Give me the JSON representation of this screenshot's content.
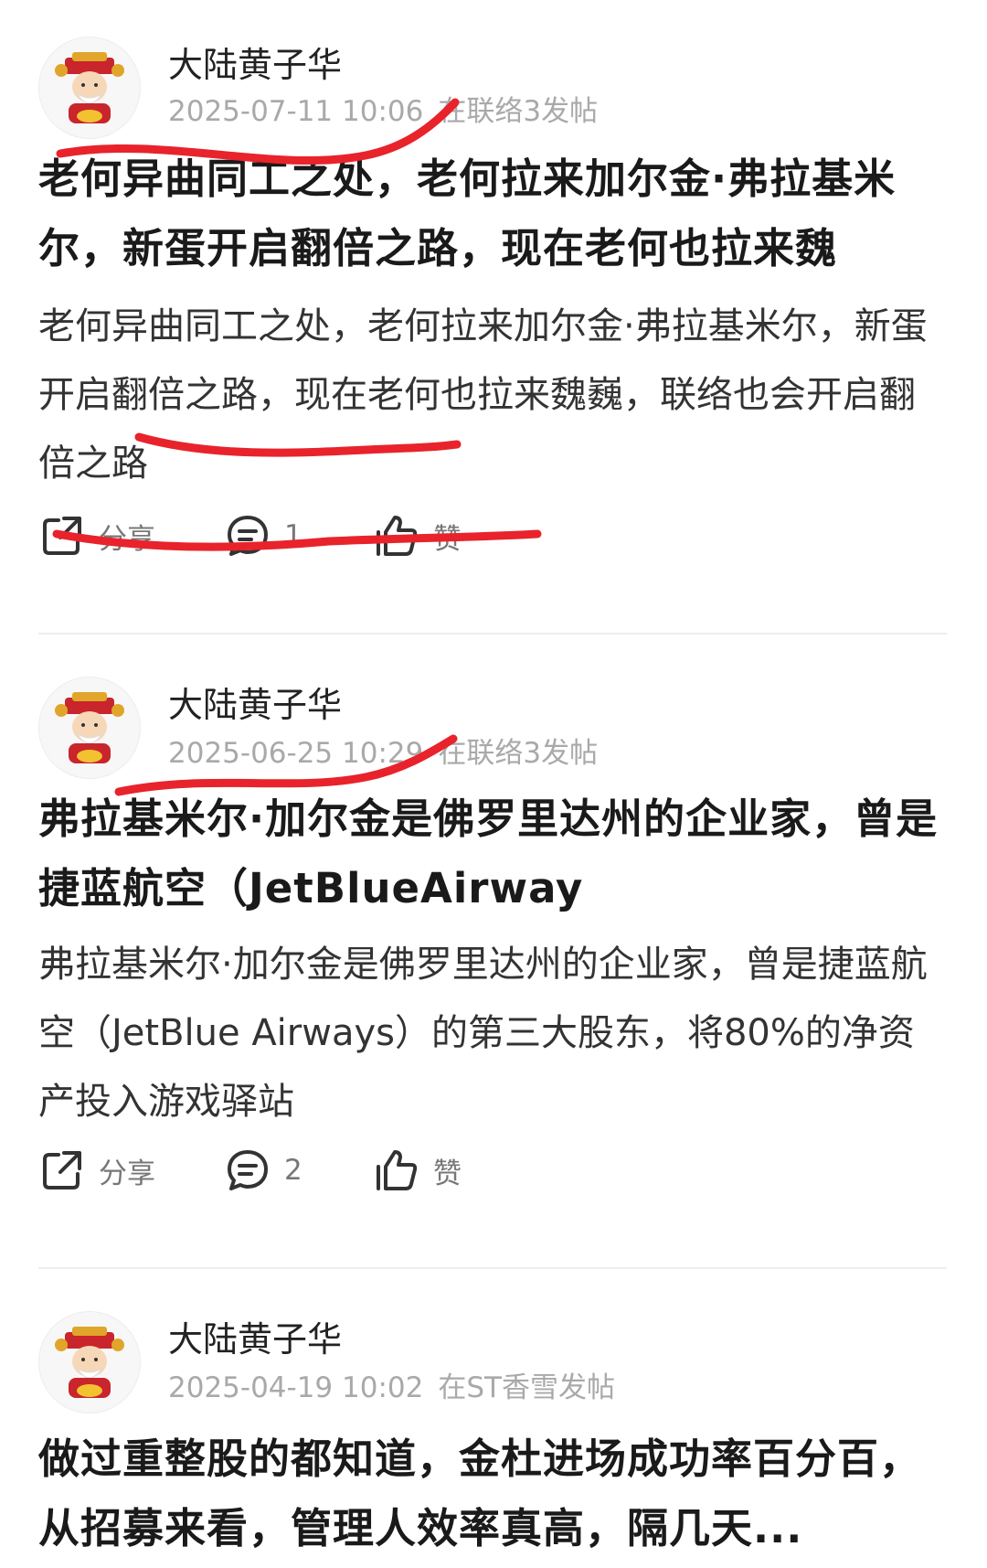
{
  "posts": [
    {
      "username": "大陆黄子华",
      "date": "2025-07-11 10:06",
      "source": "在联络3发帖",
      "title": "老何异曲同工之处，老何拉来加尔金·弗拉基米尔，新蛋开启翻倍之路，现在老何也拉来魏",
      "body": "老何异曲同工之处，老何拉来加尔金·弗拉基米尔，新蛋开启翻倍之路，现在老何也拉来魏巍，联络也会开启翻倍之路",
      "share_label": "分享",
      "comment_count": "1",
      "like_label": "赞"
    },
    {
      "username": "大陆黄子华",
      "date": "2025-06-25 10:29",
      "source": "在联络3发帖",
      "title": "弗拉基米尔·加尔金是佛罗里达州的企业家，曾是捷蓝航空（JetBlueAirway",
      "body": "弗拉基米尔·加尔金是佛罗里达州的企业家，曾是捷蓝航空（JetBlue Airways）的第三大股东，将80%的净资产投入游戏驿站",
      "share_label": "分享",
      "comment_count": "2",
      "like_label": "赞"
    },
    {
      "username": "大陆黄子华",
      "date": "2025-04-19 10:02",
      "source": "在ST香雪发帖",
      "title": "做过重整股的都知道，金杜进场成功率百分百，从招募来看，管理人效率真高，隔几天..."
    }
  ],
  "icons": {
    "share": "share-icon",
    "comment": "comment-icon",
    "like": "thumbs-up-icon",
    "avatar": "fortune-god-avatar"
  },
  "colors": {
    "annotation_red": "#e8232b",
    "meta_gray": "#a9a9a9",
    "title": "#1a1a1a"
  }
}
